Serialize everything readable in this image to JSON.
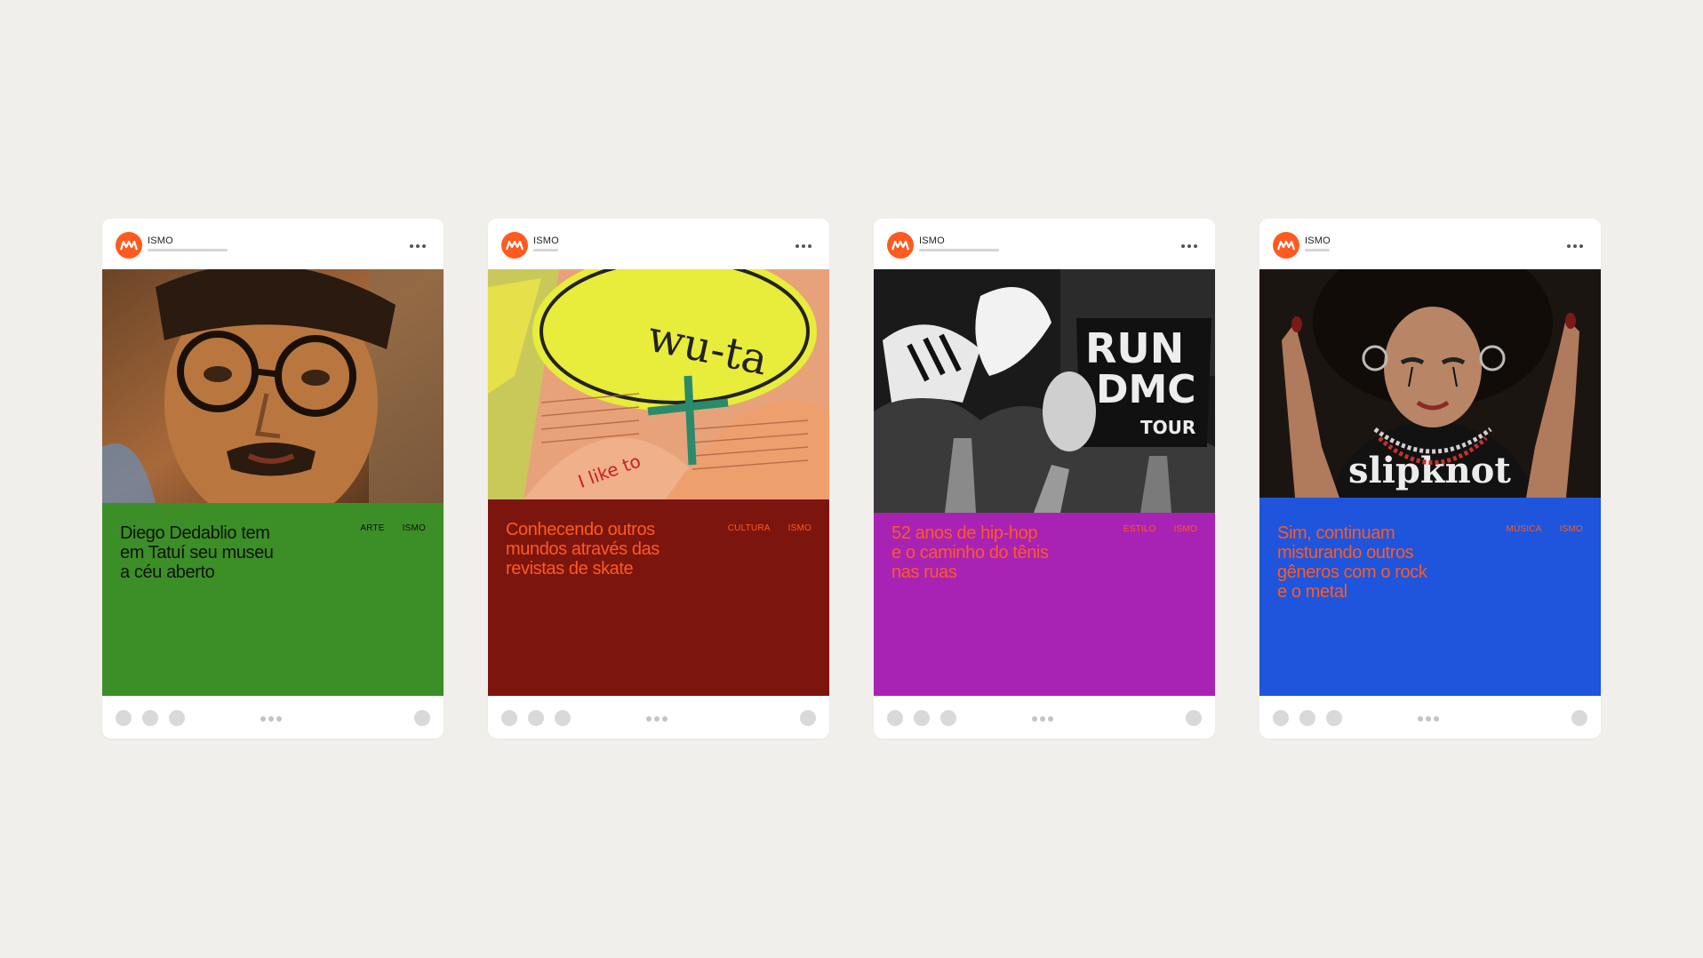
{
  "brand": {
    "accent": "#ff5a1f",
    "handle": "ISMO",
    "logo_icon": "ismo-logo-icon"
  },
  "posts": [
    {
      "image_desc_icon": "oil-painting-portrait-image",
      "title": "Diego Dedablio tem\nem Tatuí seu museu\na céu aberto",
      "tag_category": "ARTE",
      "tag_brand": "ISMO",
      "bg_color": "#3b8f26",
      "text_color": "#111111"
    },
    {
      "image_desc_icon": "skate-magazines-image",
      "title": "Conhecendo outros\nmundos através das\nrevistas de skate",
      "tag_category": "CULTURA",
      "tag_brand": "ISMO",
      "bg_color": "#7c150e",
      "text_color": "#ff5a1f"
    },
    {
      "image_desc_icon": "run-dmc-concert-image",
      "title": "52 anos de hip-hop\ne o caminho do tênis\nnas ruas",
      "tag_category": "ESTILO",
      "tag_brand": "ISMO",
      "bg_color": "#a823b4",
      "text_color": "#ff5a1f"
    },
    {
      "image_desc_icon": "woman-metal-portrait-image",
      "title": "Sim, continuam\nmisturando outros\ngêneros com o rock\ne o metal",
      "tag_category": "MÚSICA",
      "tag_brand": "ISMO",
      "bg_color": "#1e55dc",
      "text_color": "#ff5a1f"
    }
  ]
}
